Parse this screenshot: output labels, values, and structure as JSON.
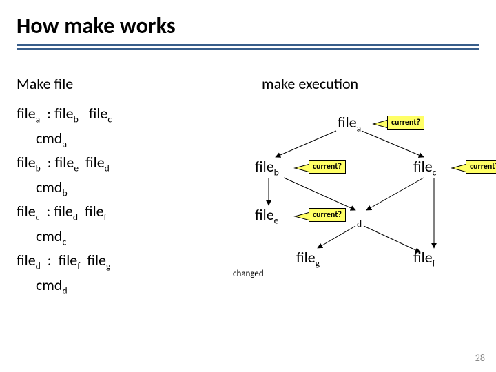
{
  "title": "How make works",
  "headers": {
    "left": "Make file",
    "right": "make execution"
  },
  "makefile": {
    "rules": [
      {
        "target": "file",
        "tsub": "a",
        "deps": [
          [
            "file",
            "b"
          ],
          [
            "file",
            "c"
          ]
        ],
        "cmd": "cmd",
        "csub": "a"
      },
      {
        "target": "file",
        "tsub": "b",
        "deps": [
          [
            "file",
            "e"
          ],
          [
            "file",
            "d"
          ]
        ],
        "cmd": "cmd",
        "csub": "b"
      },
      {
        "target": "file",
        "tsub": "c",
        "deps": [
          [
            "file",
            "d"
          ],
          [
            "file",
            "f"
          ]
        ],
        "cmd": "cmd",
        "csub": "c"
      },
      {
        "target": "file",
        "tsub": "d",
        "deps": [
          [
            "file",
            "f"
          ],
          [
            "file",
            "g"
          ]
        ],
        "cmd": "cmd",
        "csub": "d"
      }
    ]
  },
  "diagram": {
    "nodes": {
      "a": {
        "label": "file",
        "sub": "a"
      },
      "b": {
        "label": "file",
        "sub": "b"
      },
      "c": {
        "label": "file",
        "sub": "c"
      },
      "d": {
        "label": "",
        "sub": "d"
      },
      "e": {
        "label": "file",
        "sub": "e"
      },
      "f": {
        "label": "file",
        "sub": "f"
      },
      "g": {
        "label": "file",
        "sub": "g"
      }
    },
    "tags": {
      "a": "current?",
      "b": "current?",
      "c": "current?",
      "e": "current?"
    },
    "changed_label": "changed"
  },
  "page_number": "28"
}
